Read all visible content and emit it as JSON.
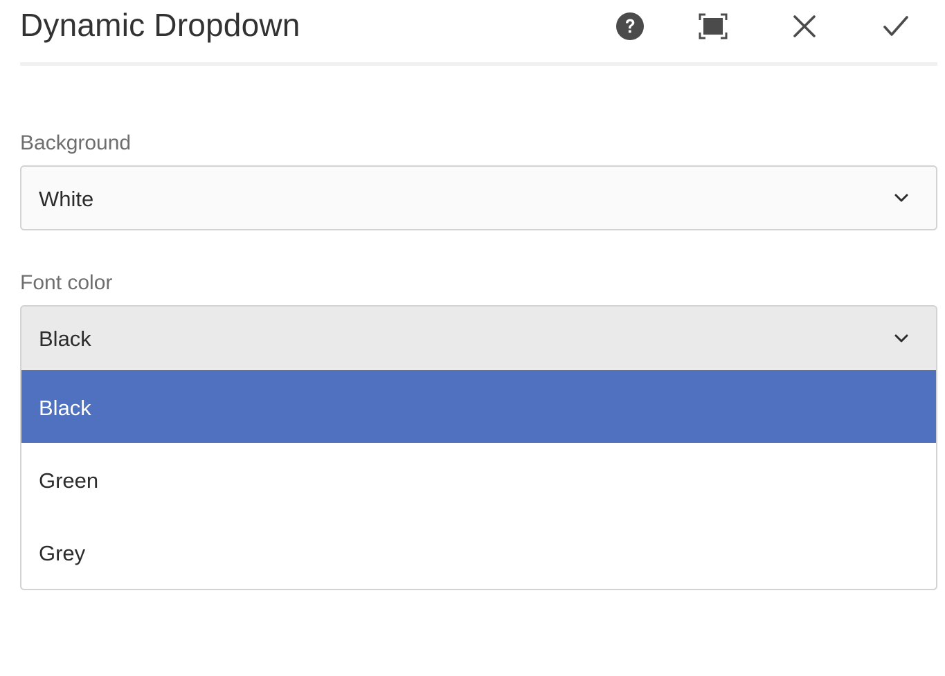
{
  "dialog": {
    "title": "Dynamic Dropdown",
    "buttons": {
      "help_icon": "question-circle-icon",
      "fullscreen_icon": "fullscreen-icon",
      "close_icon": "close-icon",
      "done_icon": "checkmark-icon"
    }
  },
  "fields": {
    "background": {
      "label": "Background",
      "value": "White"
    },
    "font_color": {
      "label": "Font color",
      "value": "Black",
      "expanded": true,
      "options": [
        "Black",
        "Green",
        "Grey"
      ],
      "selected_index": 0
    }
  },
  "colors": {
    "selected_option_bg": "#5070c0",
    "icon_color": "#4b4b4b",
    "open_select_bg": "#eaeaea"
  }
}
